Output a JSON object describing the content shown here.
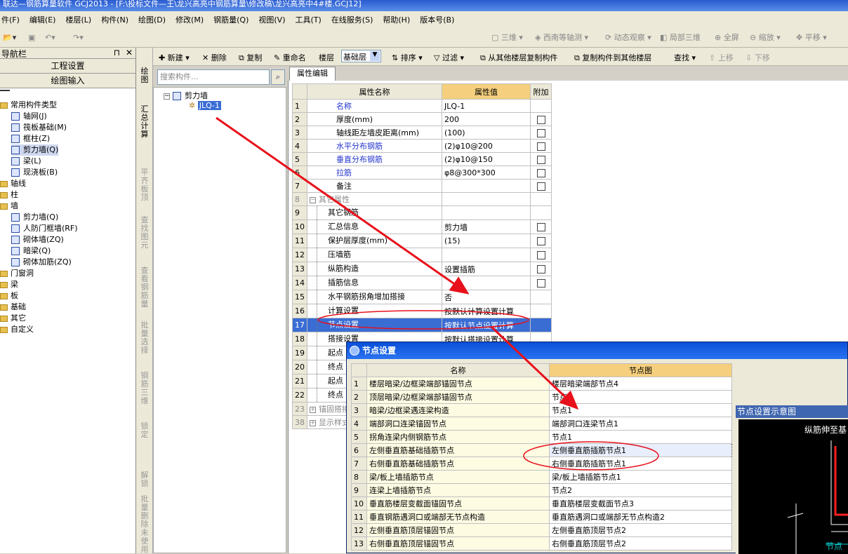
{
  "title": "联达—钢筋算量软件 GCJ2013 - [F:\\投标文件—王\\龙兴高亮中钢筋算量\\修改稿\\龙兴高亮中4#楼.GCJ12]",
  "menu": [
    "件(F)",
    "编辑(E)",
    "楼层(L)",
    "构件(N)",
    "绘图(D)",
    "修改(M)",
    "钢筋量(Q)",
    "视图(V)",
    "工具(T)",
    "在线服务(S)",
    "帮助(H)",
    "版本号(B)"
  ],
  "std_toolbar": {
    "three_d": "三维",
    "view": "西南等轴测",
    "dynamic": "动态观察",
    "local3d": "局部三维",
    "fullscreen": "全屏",
    "zoom": "缩放",
    "pan": "平移"
  },
  "nav": {
    "title": "导航栏",
    "project_settings": "工程设置",
    "drawing_input": "绘图输入",
    "items": [
      {
        "label": "常用构件类型"
      },
      {
        "label": "轴网(J)"
      },
      {
        "label": "筏板基础(M)"
      },
      {
        "label": "框柱(Z)"
      },
      {
        "label": "剪力墙(Q)"
      },
      {
        "label": "梁(L)"
      },
      {
        "label": "现浇板(B)"
      },
      {
        "label": "轴线"
      },
      {
        "label": "柱"
      },
      {
        "label": "墙"
      },
      {
        "label": "剪力墙(Q)"
      },
      {
        "label": "人防门框墙(RF)"
      },
      {
        "label": "砌体墙(ZQ)"
      },
      {
        "label": "暗梁(Q)"
      },
      {
        "label": "砌体加筋(ZQ)"
      },
      {
        "label": "门窗洞"
      },
      {
        "label": "梁"
      },
      {
        "label": "板"
      },
      {
        "label": "基础"
      },
      {
        "label": "其它"
      },
      {
        "label": "自定义"
      }
    ]
  },
  "vstrip": [
    "绘图",
    "汇总计算",
    "平齐板顶",
    "查找图元",
    "查看钢筋量",
    "批量选择",
    "钢筋三维",
    "锁定",
    "解锁",
    "批量删除未使用"
  ],
  "comp_toolbar": {
    "new": "新建",
    "delete": "删除",
    "copy": "复制",
    "rename": "重命名",
    "floor": "楼层",
    "floor_value": "基础层",
    "sort": "排序",
    "filter": "过滤",
    "copy_from": "从其他楼层复制构件",
    "copy_to": "复制构件到其他楼层",
    "find": "查找",
    "up": "上移",
    "down": "下移"
  },
  "search": {
    "placeholder": "搜索构件..."
  },
  "comp_tree": {
    "root": "剪力墙",
    "child": "JLQ-1"
  },
  "props": {
    "tab": "属性编辑",
    "headers": {
      "name": "属性名称",
      "value": "属性值",
      "extra": "附加"
    },
    "rows": [
      {
        "n": "1",
        "name": "名称",
        "value": "JLQ-1",
        "blue": true,
        "chk": false
      },
      {
        "n": "2",
        "name": "厚度(mm)",
        "value": "200",
        "chk": true
      },
      {
        "n": "3",
        "name": "轴线距左墙皮距离(mm)",
        "value": "(100)",
        "chk": true
      },
      {
        "n": "4",
        "name": "水平分布钢筋",
        "value": "(2)φ10@200",
        "blue": true,
        "chk": true
      },
      {
        "n": "5",
        "name": "垂直分布钢筋",
        "value": "(2)φ10@150",
        "blue": true,
        "chk": true
      },
      {
        "n": "6",
        "name": "拉筋",
        "value": "φ8@300*300",
        "blue": true,
        "chk": true
      },
      {
        "n": "7",
        "name": "备注",
        "value": "",
        "chk": true
      },
      {
        "n": "8",
        "name": "其它属性",
        "value": "",
        "group": true
      },
      {
        "n": "9",
        "name": "其它钢筋",
        "value": "",
        "sub": true
      },
      {
        "n": "10",
        "name": "汇总信息",
        "value": "剪力墙",
        "sub": true,
        "chk": true
      },
      {
        "n": "11",
        "name": "保护层厚度(mm)",
        "value": "(15)",
        "sub": true,
        "chk": true
      },
      {
        "n": "12",
        "name": "压墙筋",
        "value": "",
        "sub": true,
        "chk": true
      },
      {
        "n": "13",
        "name": "纵筋构造",
        "value": "设置插筋",
        "sub": true,
        "chk": true
      },
      {
        "n": "14",
        "name": "插筋信息",
        "value": "",
        "sub": true,
        "chk": true
      },
      {
        "n": "15",
        "name": "水平钢筋拐角增加搭接",
        "value": "否",
        "sub": true
      },
      {
        "n": "16",
        "name": "计算设置",
        "value": "按默认计算设置计算",
        "sub": true
      },
      {
        "n": "17",
        "name": "节点设置",
        "value": "按默认节点设置计算",
        "sub": true,
        "hl": true
      },
      {
        "n": "18",
        "name": "搭接设置",
        "value": "按默认搭接设置计算",
        "sub": true
      },
      {
        "n": "19",
        "name": "起点",
        "value": "",
        "sub": true
      },
      {
        "n": "20",
        "name": "终点",
        "value": "",
        "sub": true
      },
      {
        "n": "21",
        "name": "起点",
        "value": "",
        "sub": true
      },
      {
        "n": "22",
        "name": "终点",
        "value": "",
        "sub": true
      },
      {
        "n": "23",
        "name": "锚固搭接",
        "value": "",
        "group": true,
        "plus": true
      },
      {
        "n": "38",
        "name": "显示样式",
        "value": "",
        "group": true,
        "plus": true
      }
    ]
  },
  "dialog": {
    "title": "节点设置",
    "headers": {
      "name": "名称",
      "value": "节点图"
    },
    "rows": [
      {
        "n": "1",
        "name": "楼层暗梁/边框梁端部锚固节点",
        "value": "楼层暗梁端部节点4"
      },
      {
        "n": "2",
        "name": "顶层暗梁/边框梁端部锚固节点",
        "value": "节点1"
      },
      {
        "n": "3",
        "name": "暗梁/边框梁遇连梁构造",
        "value": "节点1"
      },
      {
        "n": "4",
        "name": "端部洞口连梁锚固节点",
        "value": "端部洞口连梁节点1"
      },
      {
        "n": "5",
        "name": "拐角连梁内侧钢筋节点",
        "value": "节点1"
      },
      {
        "n": "6",
        "name": "左侧垂直筋基础插筋节点",
        "value": "左侧垂直筋插筋节点1",
        "hl": true
      },
      {
        "n": "7",
        "name": "右侧垂直筋基础插筋节点",
        "value": "右侧垂直筋插筋节点1"
      },
      {
        "n": "8",
        "name": "梁/板上墙插筋节点",
        "value": "梁/板上墙插筋节点1"
      },
      {
        "n": "9",
        "name": "连梁上墙插筋节点",
        "value": "节点2"
      },
      {
        "n": "10",
        "name": "垂直筋楼层变截面锚固节点",
        "value": "垂直筋楼层变截面节点3"
      },
      {
        "n": "11",
        "name": "垂直钢筋遇洞口或端部无节点构造",
        "value": "垂直筋遇洞口或端部无节点构造2"
      },
      {
        "n": "12",
        "name": "左侧垂直筋顶层锚固节点",
        "value": "左侧垂直筋顶层节点2"
      },
      {
        "n": "13",
        "name": "右侧垂直筋顶层锚固节点",
        "value": "右侧垂直筋顶层节点2"
      }
    ],
    "preview": {
      "title": "节点设置示意图",
      "label_top": "纵筋伸至基",
      "label_bottom": "节点"
    }
  },
  "colors": {
    "arrow": "#e8101a",
    "blue_text": "#2233cc",
    "header_orange": "#f5cf7d",
    "title_blue": "#2a5bd0"
  }
}
